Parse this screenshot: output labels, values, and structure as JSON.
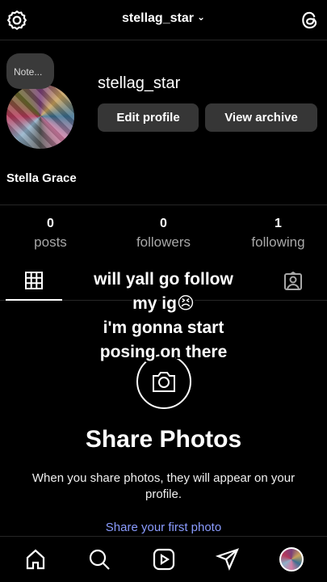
{
  "header": {
    "username": "stellag_star",
    "chevron": "⌄",
    "left_icon": "settings-icon",
    "right_icon": "threads-icon"
  },
  "profile": {
    "note": "Note...",
    "username": "stellag_star",
    "display_name": "Stella Grace",
    "edit_button": "Edit profile",
    "archive_button": "View archive"
  },
  "stats": [
    {
      "count": "0",
      "label": "posts"
    },
    {
      "count": "0",
      "label": "followers"
    },
    {
      "count": "1",
      "label": "following"
    }
  ],
  "tabs": {
    "grid_icon": "grid-icon",
    "tagged_icon": "tagged-icon"
  },
  "overlay": {
    "line1": "will yall go follow",
    "line2": "my ig😣",
    "line3": "i'm gonna start",
    "line4": "posing on there"
  },
  "empty_state": {
    "icon": "camera-icon",
    "title": "Share Photos",
    "description": "When you share photos, they will appear on your profile.",
    "link": "Share your first photo"
  },
  "bottom_nav": [
    "home-icon",
    "search-icon",
    "reels-icon",
    "send-icon",
    "profile-avatar"
  ]
}
